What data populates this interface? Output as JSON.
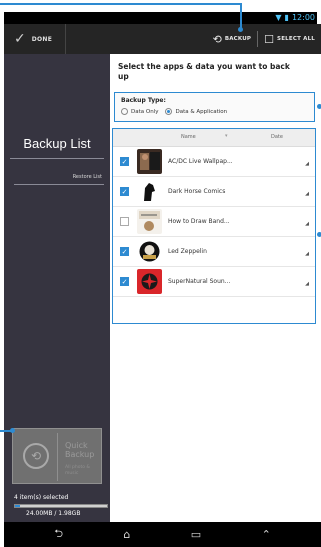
{
  "status_bar": {
    "time": "12:00"
  },
  "action_bar": {
    "done_label": "DONE",
    "backup_label": "BACKUP",
    "select_all_label": "SELECT ALL"
  },
  "sidebar": {
    "title": "Backup List",
    "subtitle": "Restore List",
    "quick_backup": {
      "title": "Quick Backup",
      "subtitle": "All photo & music"
    },
    "selected_text": "4 item(s) selected",
    "size_text": "24.00MB / 1.98GB",
    "progress": 0.05
  },
  "panel": {
    "heading": "Select the apps & data you want to back up",
    "backup_type_label": "Backup Type:",
    "options": [
      {
        "label": "Data Only",
        "selected": false
      },
      {
        "label": "Data & Application",
        "selected": true
      }
    ],
    "columns": {
      "name": "Name",
      "date": "Date"
    },
    "items": [
      {
        "name": "AC/DC Live Wallpap...",
        "checked": true
      },
      {
        "name": "Dark Horse Comics",
        "checked": true
      },
      {
        "name": "How to Draw Band...",
        "checked": false
      },
      {
        "name": "Led Zeppelin",
        "checked": true
      },
      {
        "name": "SuperNatural Soun...",
        "checked": true
      }
    ]
  },
  "colors": {
    "accent": "#2d8ad1",
    "sidebar": "#363440",
    "action_bar": "#252525"
  }
}
